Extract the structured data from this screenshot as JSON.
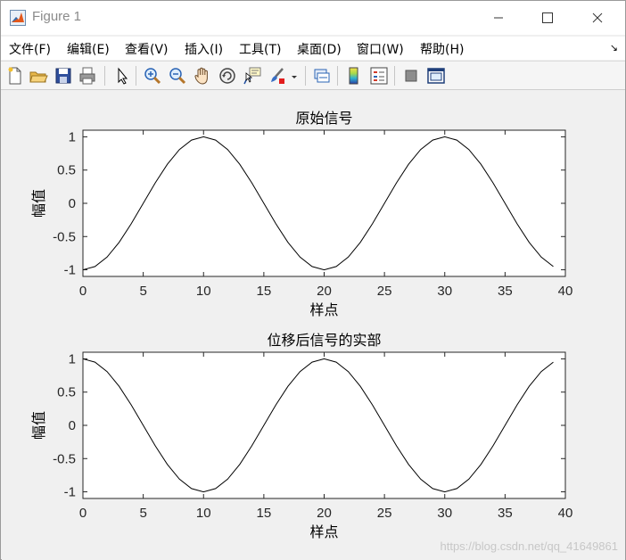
{
  "window": {
    "title": "Figure 1"
  },
  "menu": {
    "items": [
      "文件(F)",
      "编辑(E)",
      "查看(V)",
      "插入(I)",
      "工具(T)",
      "桌面(D)",
      "窗口(W)",
      "帮助(H)"
    ],
    "corner_glyph": "↘"
  },
  "toolbar": {
    "icons": [
      "new-figure-icon",
      "open-file-icon",
      "save-icon",
      "print-icon",
      "select-arrow-icon",
      "zoom-in-icon",
      "zoom-out-icon",
      "pan-hand-icon",
      "rotate-3d-icon",
      "data-cursor-icon",
      "brush-icon",
      "link-plot-icon",
      "colorbar-icon",
      "legend-icon",
      "hide-plot-tools-icon",
      "show-plot-tools-icon"
    ]
  },
  "watermark": "https://blog.csdn.net/qq_41649861",
  "chart_data": [
    {
      "type": "line",
      "title": "原始信号",
      "xlabel": "样点",
      "ylabel": "幅值",
      "xlim": [
        0,
        40
      ],
      "ylim": [
        -1.1,
        1.1
      ],
      "xticks": [
        0,
        5,
        10,
        15,
        20,
        25,
        30,
        35,
        40
      ],
      "yticks": [
        1,
        0.5,
        0,
        -0.5,
        -1
      ],
      "ytick_labels": [
        "1",
        "0.5",
        "0",
        "-0.5",
        "-1"
      ],
      "x": [
        0,
        1,
        2,
        3,
        4,
        5,
        6,
        7,
        8,
        9,
        10,
        11,
        12,
        13,
        14,
        15,
        16,
        17,
        18,
        19,
        20,
        21,
        22,
        23,
        24,
        25,
        26,
        27,
        28,
        29,
        30,
        31,
        32,
        33,
        34,
        35,
        36,
        37,
        38,
        39
      ],
      "values": [
        -1.0,
        -0.951,
        -0.809,
        -0.588,
        -0.309,
        0.0,
        0.309,
        0.588,
        0.809,
        0.951,
        1.0,
        0.951,
        0.809,
        0.588,
        0.309,
        0.0,
        -0.309,
        -0.588,
        -0.809,
        -0.951,
        -1.0,
        -0.951,
        -0.809,
        -0.588,
        -0.309,
        0.0,
        0.309,
        0.588,
        0.809,
        0.951,
        1.0,
        0.951,
        0.809,
        0.588,
        0.309,
        0.0,
        -0.309,
        -0.588,
        -0.809,
        -0.951
      ],
      "line_color": "#000000"
    },
    {
      "type": "line",
      "title": "位移后信号的实部",
      "xlabel": "样点",
      "ylabel": "幅值",
      "xlim": [
        0,
        40
      ],
      "ylim": [
        -1.1,
        1.1
      ],
      "xticks": [
        0,
        5,
        10,
        15,
        20,
        25,
        30,
        35,
        40
      ],
      "yticks": [
        1,
        0.5,
        0,
        -0.5,
        -1
      ],
      "ytick_labels": [
        "1",
        "0.5",
        "0",
        "-0.5",
        "-1"
      ],
      "x": [
        0,
        1,
        2,
        3,
        4,
        5,
        6,
        7,
        8,
        9,
        10,
        11,
        12,
        13,
        14,
        15,
        16,
        17,
        18,
        19,
        20,
        21,
        22,
        23,
        24,
        25,
        26,
        27,
        28,
        29,
        30,
        31,
        32,
        33,
        34,
        35,
        36,
        37,
        38,
        39
      ],
      "values": [
        1.0,
        0.951,
        0.809,
        0.588,
        0.309,
        0.0,
        -0.309,
        -0.588,
        -0.809,
        -0.951,
        -1.0,
        -0.951,
        -0.809,
        -0.588,
        -0.309,
        0.0,
        0.309,
        0.588,
        0.809,
        0.951,
        1.0,
        0.951,
        0.809,
        0.588,
        0.309,
        0.0,
        -0.309,
        -0.588,
        -0.809,
        -0.951,
        -1.0,
        -0.951,
        -0.809,
        -0.588,
        -0.309,
        0.0,
        0.309,
        0.588,
        0.809,
        0.951
      ],
      "line_color": "#000000"
    }
  ]
}
